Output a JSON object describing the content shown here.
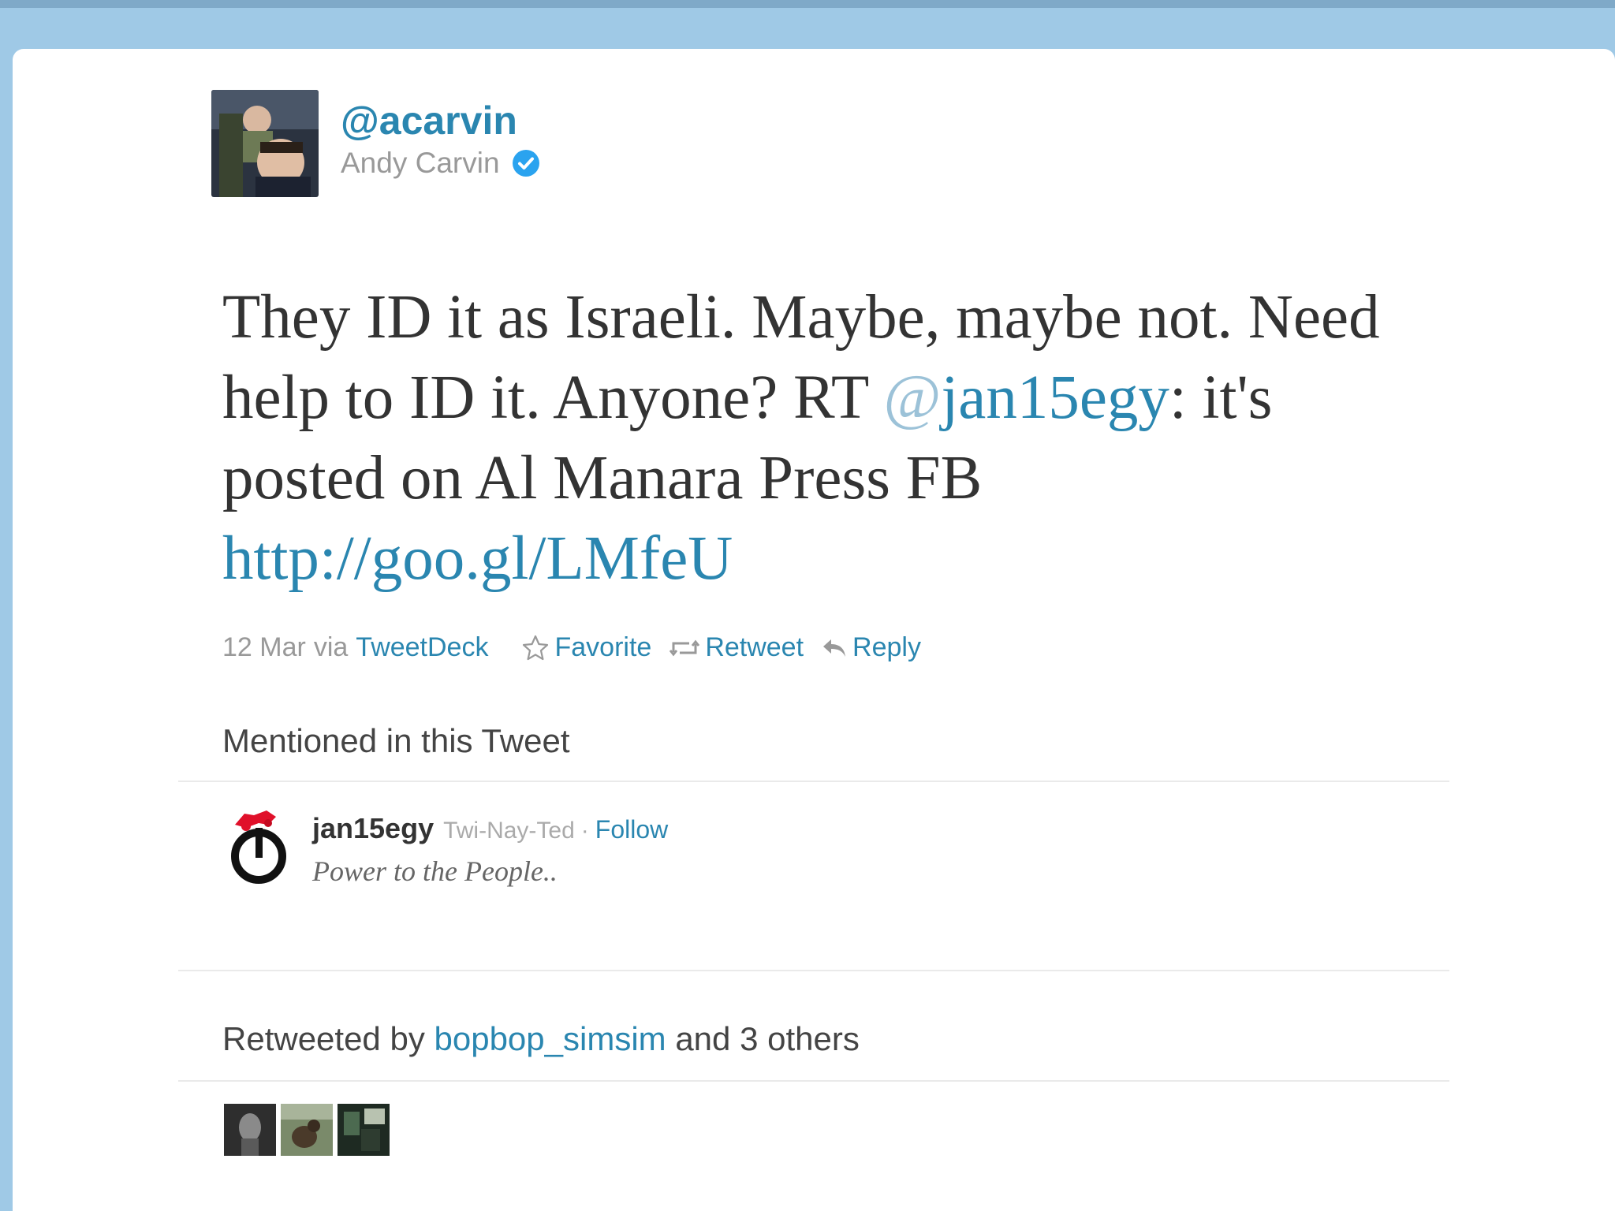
{
  "tweet": {
    "handle": "@acarvin",
    "display_name": "Andy Carvin",
    "verified": true,
    "text_part1": "They ID it as Israeli. Maybe, maybe not. Need help to ID it. Anyone? RT ",
    "mention_at": "@",
    "mention_name": "jan15egy",
    "text_part2": ": it's posted on Al Manara Press FB ",
    "link": "http://goo.gl/LMfeU",
    "date": "12 Mar",
    "via": "via",
    "client": "TweetDeck"
  },
  "actions": {
    "favorite": "Favorite",
    "retweet": "Retweet",
    "reply": "Reply"
  },
  "mentioned": {
    "title": "Mentioned in this Tweet",
    "username": "jan15egy",
    "name": "Twi-Nay-Ted",
    "separator": "·",
    "follow": "Follow",
    "bio": "Power to the People.."
  },
  "retweets": {
    "prefix": "Retweeted by",
    "user": "bopbop_simsim",
    "suffix": "and 3 others"
  },
  "colors": {
    "link": "#2a86b0",
    "background": "#9fc9e6",
    "verified": "#2aa3ef"
  }
}
